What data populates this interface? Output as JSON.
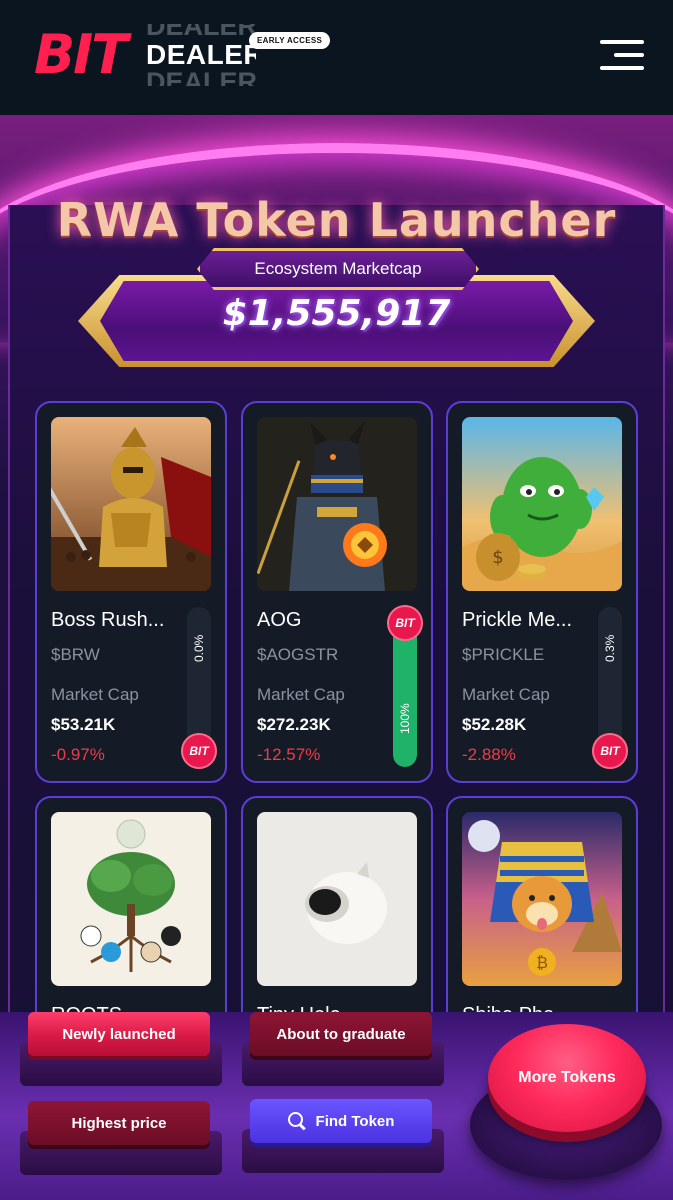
{
  "header": {
    "logo_bit": "BIT",
    "logo_dealer": "DEALER",
    "early_access": "EARLY ACCESS"
  },
  "hero": {
    "title": "RWA Token Launcher",
    "eco_label": "Ecosystem Marketcap",
    "eco_value": "$1,555,917"
  },
  "tokens": [
    {
      "name": "Boss Rush...",
      "ticker": "$BRW",
      "mc_label": "Market Cap",
      "mc": "$53.21K",
      "change": "-0.97%",
      "progress_label": "0.0%",
      "progress": 0.0
    },
    {
      "name": "AOG",
      "ticker": "$AOGSTR",
      "mc_label": "Market Cap",
      "mc": "$272.23K",
      "change": "-12.57%",
      "progress_label": "100%",
      "progress": 100
    },
    {
      "name": "Prickle Me...",
      "ticker": "$PRICKLE",
      "mc_label": "Market Cap",
      "mc": "$52.28K",
      "change": "-2.88%",
      "progress_label": "0.3%",
      "progress": 0.3
    },
    {
      "name": "ROOTS"
    },
    {
      "name": "Tiny Hole"
    },
    {
      "name": "Shiba Pha..."
    }
  ],
  "bit_badge": "BIT",
  "controls": {
    "newly_launched": "Newly launched",
    "about_to_graduate": "About to graduate",
    "highest_price": "Highest price",
    "find_token": "Find Token",
    "more_tokens": "More Tokens"
  },
  "colors": {
    "accent_red": "#ff2050",
    "positive_green": "#1fb36a",
    "negative_red": "#ef3b48",
    "card_border": "#5a3fd6"
  }
}
